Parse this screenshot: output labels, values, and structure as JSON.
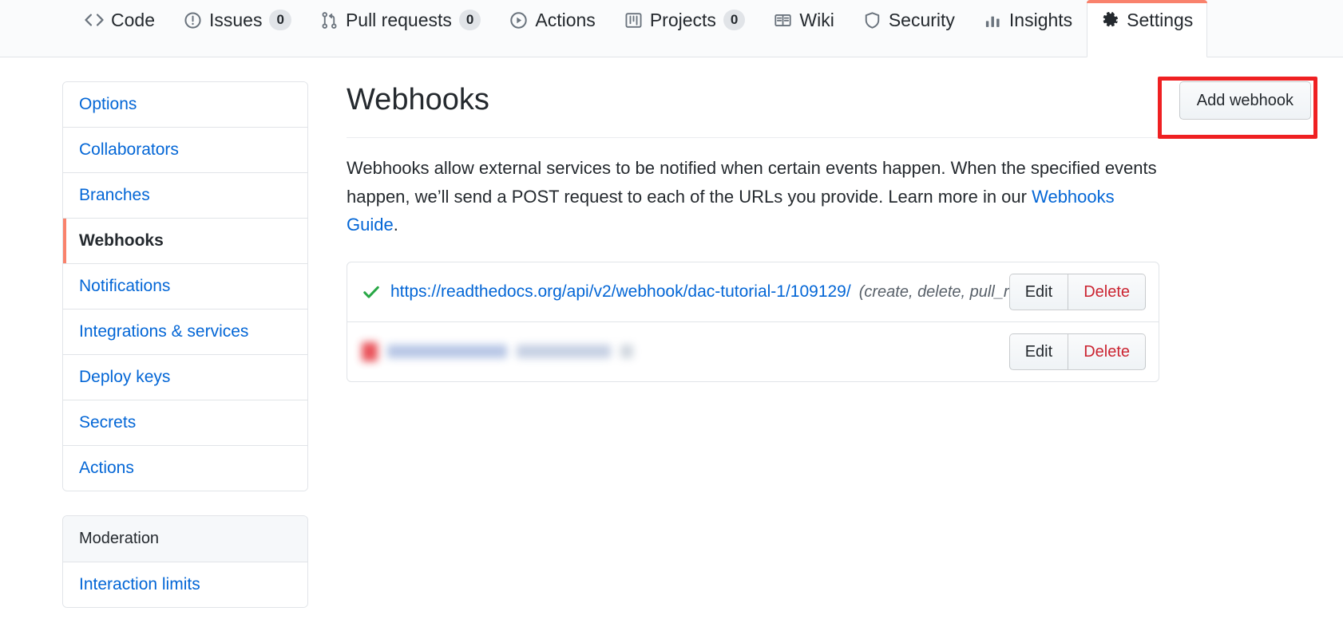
{
  "repo_nav": {
    "items": [
      {
        "label": "Code",
        "icon": "code-icon",
        "count": null,
        "selected": false
      },
      {
        "label": "Issues",
        "icon": "issue-opened-icon",
        "count": "0",
        "selected": false
      },
      {
        "label": "Pull requests",
        "icon": "git-pull-request-icon",
        "count": "0",
        "selected": false
      },
      {
        "label": "Actions",
        "icon": "play-icon",
        "count": null,
        "selected": false
      },
      {
        "label": "Projects",
        "icon": "project-board-icon",
        "count": "0",
        "selected": false
      },
      {
        "label": "Wiki",
        "icon": "book-icon",
        "count": null,
        "selected": false
      },
      {
        "label": "Security",
        "icon": "shield-icon",
        "count": null,
        "selected": false
      },
      {
        "label": "Insights",
        "icon": "graph-icon",
        "count": null,
        "selected": false
      },
      {
        "label": "Settings",
        "icon": "gear-icon",
        "count": null,
        "selected": true
      }
    ],
    "selected_accent": "#f9826c"
  },
  "sidebar": {
    "primary_menu": [
      {
        "label": "Options",
        "selected": false
      },
      {
        "label": "Collaborators",
        "selected": false
      },
      {
        "label": "Branches",
        "selected": false
      },
      {
        "label": "Webhooks",
        "selected": true
      },
      {
        "label": "Notifications",
        "selected": false
      },
      {
        "label": "Integrations & services",
        "selected": false
      },
      {
        "label": "Deploy keys",
        "selected": false
      },
      {
        "label": "Secrets",
        "selected": false
      },
      {
        "label": "Actions",
        "selected": false
      }
    ],
    "moderation_menu": {
      "heading": "Moderation",
      "items": [
        {
          "label": "Interaction limits",
          "selected": false
        }
      ]
    },
    "link_color": "#0366d6",
    "active_accent": "#f9826c"
  },
  "main": {
    "title": "Webhooks",
    "add_button_label": "Add webhook",
    "annotation": {
      "target": "Add webhook",
      "color": "#ef2022"
    },
    "description": {
      "text_before_link": "Webhooks allow external services to be notified when certain events happen. When the specified events happen, we’ll send a POST request to each of the URLs you provide. Learn more in our ",
      "link_text": "Webhooks Guide",
      "text_after_link": "."
    },
    "webhooks": [
      {
        "status": "success",
        "status_icon": "check-icon",
        "status_color": "#28a745",
        "url": "https://readthedocs.org/api/v2/webhook/dac-tutorial-1/109129/",
        "events": "(create, delete, pull_request…)",
        "edit_label": "Edit",
        "delete_label": "Delete",
        "redacted": false
      },
      {
        "status": "error",
        "status_icon": "alert-icon",
        "status_color": "#cb2431",
        "url": "",
        "events": "",
        "edit_label": "Edit",
        "delete_label": "Delete",
        "redacted": true
      }
    ]
  }
}
